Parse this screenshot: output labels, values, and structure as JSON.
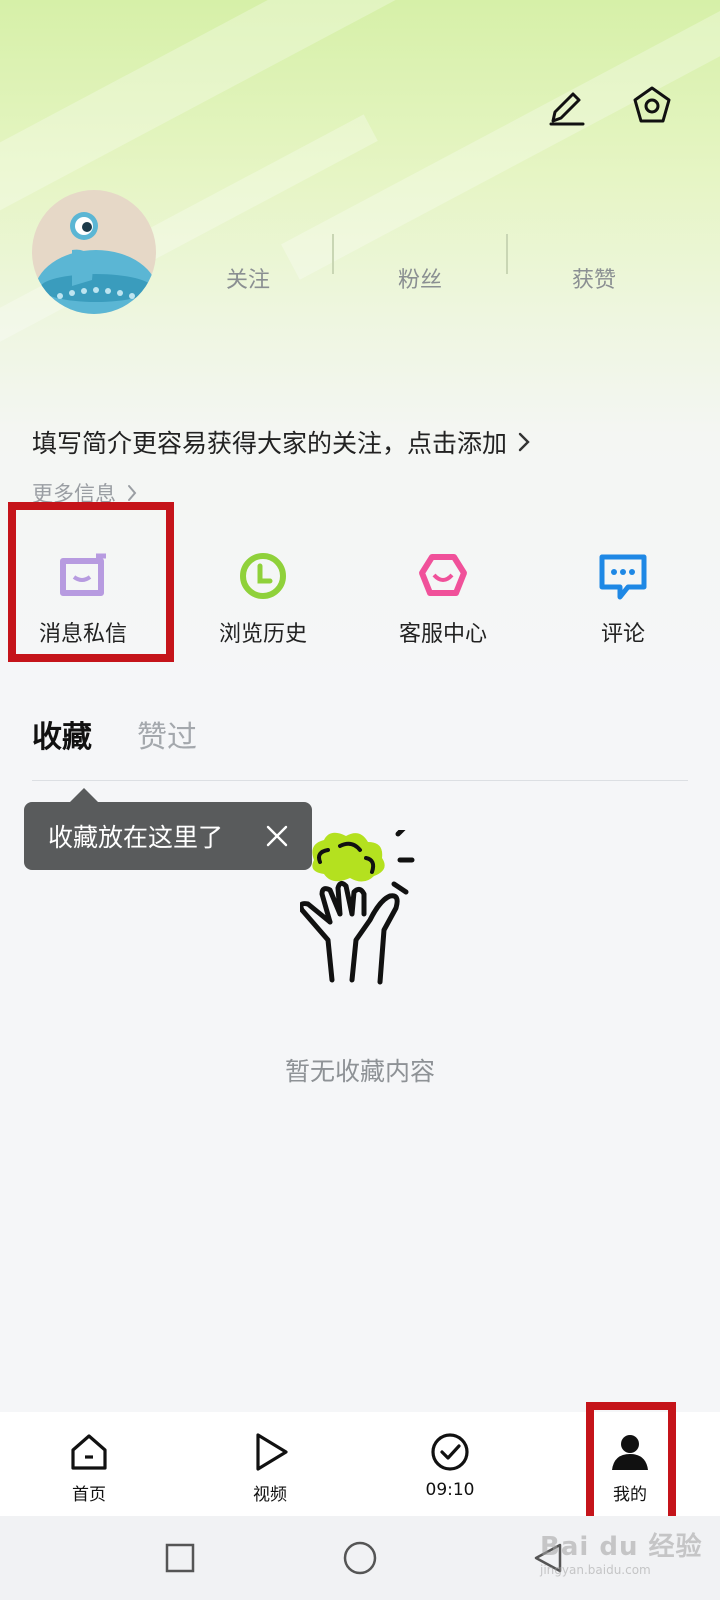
{
  "header": {
    "edit_icon": "pencil-icon",
    "settings_icon": "hexagon-gear-icon"
  },
  "profile": {
    "avatar_icon": "alien-mascot-avatar",
    "stats": [
      {
        "label": "关注"
      },
      {
        "label": "粉丝"
      },
      {
        "label": "获赞"
      }
    ],
    "intro_text": "填写简介更容易获得大家的关注，点击添加",
    "more_info": "更多信息"
  },
  "quick_actions": [
    {
      "label": "消息私信",
      "icon": "message-box-icon",
      "color": "#b79be0"
    },
    {
      "label": "浏览历史",
      "icon": "clock-history-icon",
      "color": "#8fd13a"
    },
    {
      "label": "客服中心",
      "icon": "customer-service-face-icon",
      "color": "#f0519a"
    },
    {
      "label": "评论",
      "icon": "comment-bubble-icon",
      "color": "#1e88e5"
    }
  ],
  "tabs": {
    "active": "收藏",
    "inactive": "赞过"
  },
  "tooltip": {
    "text": "收藏放在这里了"
  },
  "empty_state": {
    "text": "暂无收藏内容",
    "accent": "#b4e11f"
  },
  "bottom_nav": [
    {
      "label": "首页",
      "icon": "home-icon"
    },
    {
      "label": "视频",
      "icon": "play-icon"
    },
    {
      "label": "09:10",
      "icon": "check-circle-icon"
    },
    {
      "label": "我的",
      "icon": "person-icon"
    }
  ],
  "watermark": {
    "main": "Bai du 经验",
    "sub": "jingyan.baidu.com"
  },
  "highlight_color": "#c5141a"
}
